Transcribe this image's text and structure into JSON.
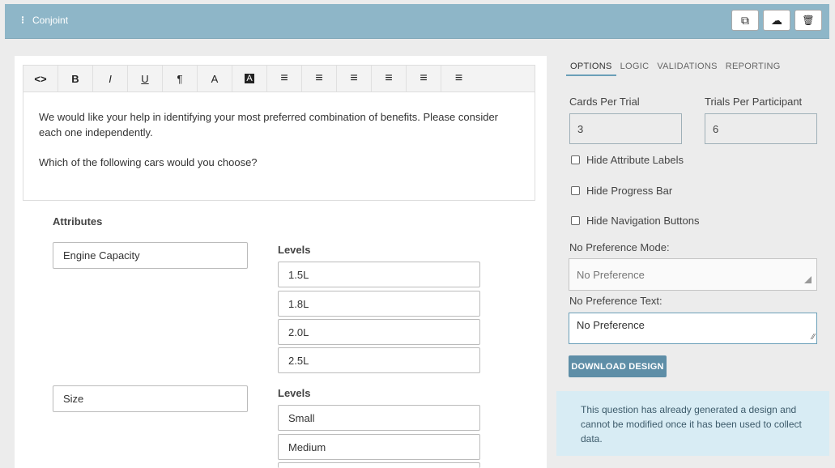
{
  "header": {
    "title": "Conjoint",
    "menu_icon": "vertical-dots-icon",
    "actions": [
      {
        "name": "copy-icon",
        "glyph": "⧉"
      },
      {
        "name": "cloud-upload-icon",
        "glyph": "☁"
      },
      {
        "name": "trash-icon",
        "glyph": "🗑"
      }
    ]
  },
  "toolbar": {
    "items": [
      {
        "name": "code-view-icon",
        "glyph": "<>"
      },
      {
        "name": "bold-icon",
        "glyph": "B"
      },
      {
        "name": "italic-icon",
        "glyph": "I"
      },
      {
        "name": "underline-icon",
        "glyph": "U"
      },
      {
        "name": "paragraph-format-icon",
        "glyph": "¶"
      },
      {
        "name": "font-color-icon",
        "glyph": "A"
      },
      {
        "name": "background-color-icon",
        "glyph": "A"
      },
      {
        "name": "bullet-list-icon",
        "glyph": "≡"
      },
      {
        "name": "numbered-list-icon",
        "glyph": "≡"
      },
      {
        "name": "align-left-icon",
        "glyph": "≡"
      },
      {
        "name": "align-center-icon",
        "glyph": "≡"
      },
      {
        "name": "align-right-icon",
        "glyph": "≡"
      },
      {
        "name": "justify-icon",
        "glyph": "≡"
      }
    ]
  },
  "editor": {
    "paragraph1": "We would like your help in identifying your most preferred combination of benefits. Please consider each one independently.",
    "paragraph2": "Which of the following cars would you choose?"
  },
  "attributes": {
    "heading": "Attributes",
    "items": [
      {
        "name": "Engine Capacity",
        "levels_label": "Levels",
        "levels": [
          "1.5L",
          "1.8L",
          "2.0L",
          "2.5L"
        ]
      },
      {
        "name": "Size",
        "levels_label": "Levels",
        "levels": [
          "Small",
          "Medium",
          ""
        ]
      }
    ]
  },
  "settings": {
    "tabs": [
      "OPTIONS",
      "LOGIC",
      "VALIDATIONS",
      "REPORTING"
    ],
    "active_tab": "OPTIONS",
    "cards_per_trial_label": "Cards Per Trial",
    "cards_per_trial_value": "3",
    "trials_per_participant_label": "Trials Per Participant",
    "trials_per_participant_value": "6",
    "hide_attribute_labels": "Hide Attribute Labels",
    "hide_progress_bar": "Hide Progress Bar",
    "hide_navigation_buttons": "Hide Navigation Buttons",
    "no_pref_mode_label": "No Preference Mode:",
    "no_pref_mode_value": "No Preference",
    "no_pref_text_label": "No Preference Text:",
    "no_pref_text_value": "No Preference",
    "download_button": "DOWNLOAD DESIGN",
    "notice": "This question has already generated a design and cannot be modified once it has been used to collect data."
  },
  "colors": {
    "header_bg": "#8eb6c8",
    "accent": "#5e8ea7",
    "notice_bg": "#d8ecf4"
  }
}
